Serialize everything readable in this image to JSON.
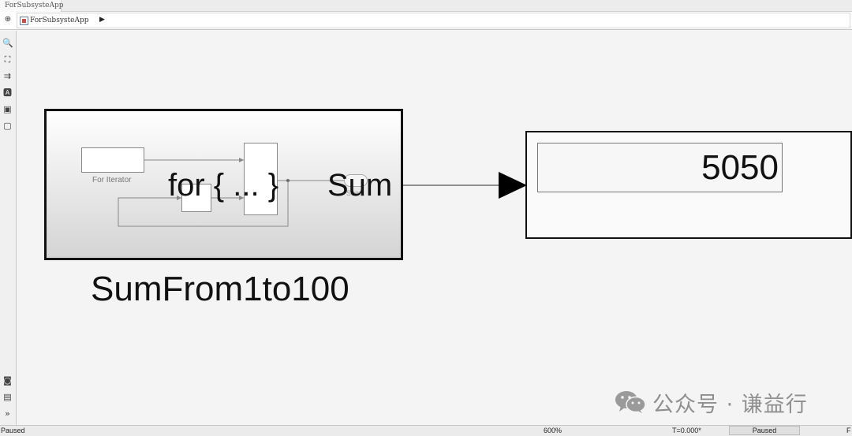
{
  "tab": {
    "label": "ForSubsysteApp"
  },
  "breadcrumb": {
    "model_name": "ForSubsysteApp"
  },
  "toolbar": {
    "icons": [
      "zoom-icon",
      "fit-view-icon",
      "signal-routing-icon",
      "annotation-icon",
      "image-icon",
      "area-icon",
      "screenshot-icon",
      "model-browser-icon",
      "expand-icon"
    ]
  },
  "subsystem": {
    "name": "SumFrom1to100",
    "icon_text": "for { ... }",
    "port_label": "Sum",
    "inner_block_label": "For Iterator",
    "inner_port_label": "Sum"
  },
  "display": {
    "value": "5050"
  },
  "watermark": {
    "text": "公众号 · 谦益行"
  },
  "status": {
    "left": "Paused",
    "zoom": "600%",
    "time": "T=0.000*",
    "state": "Paused",
    "right": "F"
  },
  "colors": {
    "block_border": "#111111",
    "line": "#555555",
    "canvas": "#f4f4f4"
  }
}
